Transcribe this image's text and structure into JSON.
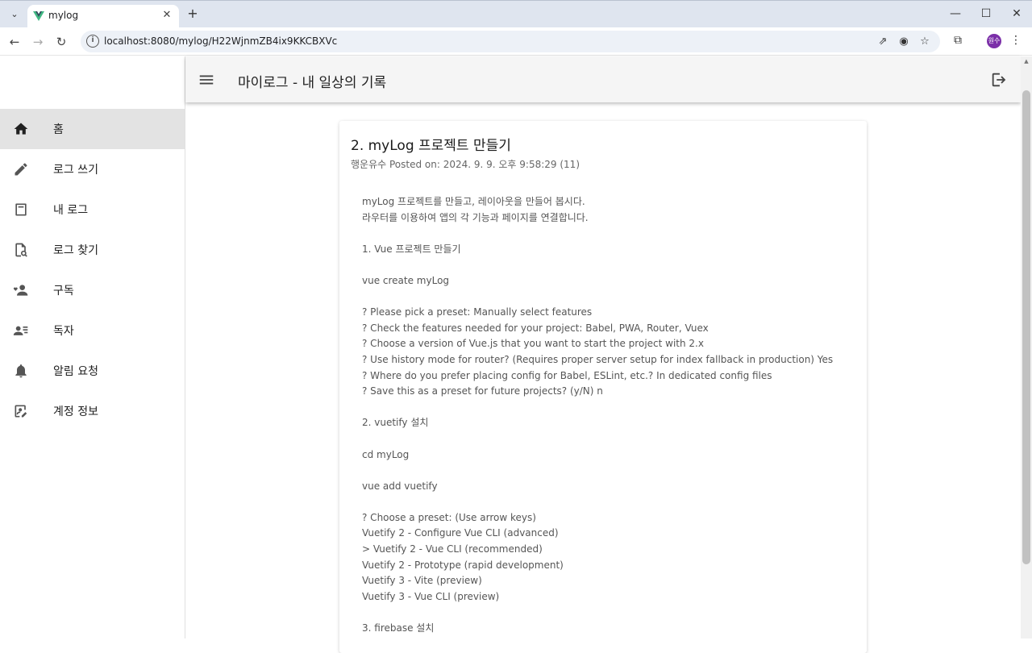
{
  "browser": {
    "tab_title": "mylog",
    "url": "localhost:8080/mylog/H22WjnmZB4ix9KKCBXVc",
    "profile_initials": "원수"
  },
  "app": {
    "title": "마이로그 - 내 일상의 기록"
  },
  "sidebar": {
    "items": [
      {
        "label": "홈",
        "icon": "home-icon",
        "active": true
      },
      {
        "label": "로그 쓰기",
        "icon": "pencil-icon"
      },
      {
        "label": "내 로그",
        "icon": "notebook-icon"
      },
      {
        "label": "로그 찾기",
        "icon": "file-search-icon"
      },
      {
        "label": "구독",
        "icon": "user-heart-icon"
      },
      {
        "label": "독자",
        "icon": "user-list-icon"
      },
      {
        "label": "알림 요청",
        "icon": "bell-icon"
      },
      {
        "label": "계정 정보",
        "icon": "account-edit-icon"
      }
    ]
  },
  "post": {
    "title": "2. myLog 프로젝트 만들기",
    "meta": "행운유수 Posted on: 2024. 9. 9. 오후 9:58:29 (11)",
    "lines": [
      "myLog 프로젝트를 만들고, 레이아웃을 만들어 봅시다.",
      "라우터를 이용하여 앱의 각 기능과 페이지를 연결합니다.",
      "",
      "1. Vue 프로젝트 만들기",
      "",
      "vue create myLog",
      "",
      "? Please pick a preset: Manually select features",
      "? Check the features needed for your project: Babel, PWA, Router, Vuex",
      "? Choose a version of Vue.js that you want to start the project with 2.x",
      "? Use history mode for router? (Requires proper server setup for index fallback in production) Yes",
      "? Where do you prefer placing config for Babel, ESLint, etc.? In dedicated config files",
      "? Save this as a preset for future projects? (y/N) n",
      "",
      "2. vuetify 설치",
      "",
      "cd myLog",
      "",
      "vue add vuetify",
      "",
      "? Choose a preset: (Use arrow keys)",
      "Vuetify 2 - Configure Vue CLI (advanced)",
      "> Vuetify 2 - Vue CLI (recommended)",
      "Vuetify 2 - Prototype (rapid development)",
      "Vuetify 3 - Vite (preview)",
      "Vuetify 3 - Vue CLI (preview)",
      "",
      "3. firebase 설치"
    ]
  }
}
